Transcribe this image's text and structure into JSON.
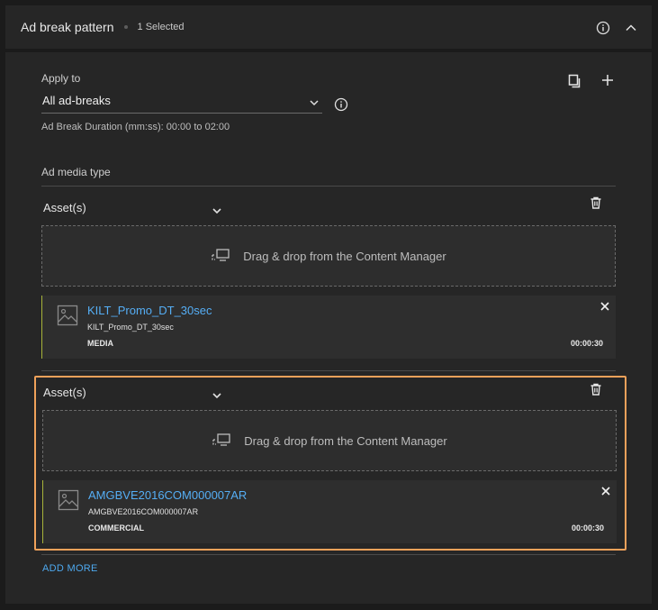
{
  "header": {
    "title": "Ad break pattern",
    "selected_text": "1 Selected",
    "info_icon": "info-icon",
    "collapse_icon": "chevron-up-icon"
  },
  "apply": {
    "label": "Apply to",
    "value": "All ad-breaks",
    "duration_text": "Ad Break Duration (mm:ss): 00:00 to 02:00"
  },
  "media_type_label": "Ad media type",
  "groups": [
    {
      "select_label": "Asset(s)",
      "drop_text": "Drag & drop from the Content Manager",
      "item": {
        "title": "KILT_Promo_DT_30sec",
        "subtitle": "KILT_Promo_DT_30sec",
        "type": "MEDIA",
        "duration": "00:00:30"
      }
    },
    {
      "select_label": "Asset(s)",
      "drop_text": "Drag & drop from the Content Manager",
      "item": {
        "title": "AMGBVE2016COM000007AR",
        "subtitle": "AMGBVE2016COM000007AR",
        "type": "COMMERCIAL",
        "duration": "00:00:30"
      }
    }
  ],
  "add_more_label": "ADD MORE",
  "colors": {
    "accent_link": "#55aef5",
    "highlight_border": "#f0a15a",
    "item_marker": "#a8b43a",
    "panel_bg": "#262626"
  }
}
